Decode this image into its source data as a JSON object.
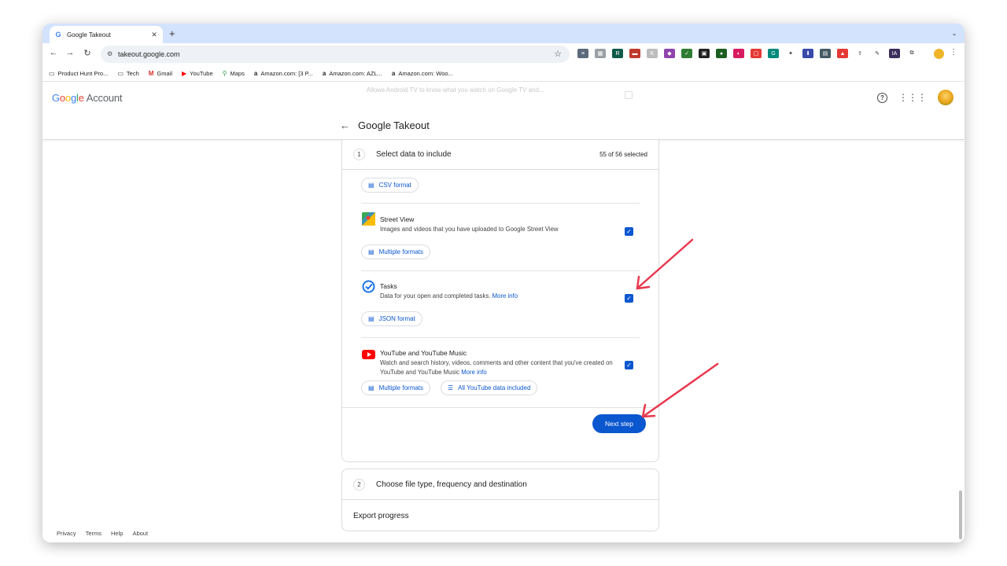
{
  "browser": {
    "tab_title": "Google Takeout",
    "tab_favicon": "G",
    "new_tab": "+",
    "url": "takeout.google.com"
  },
  "bookmarks": [
    {
      "label": "Product Hunt Pro...",
      "icon": "folder-icon",
      "glyph": "▭"
    },
    {
      "label": "Tech",
      "icon": "folder-icon",
      "glyph": "▭"
    },
    {
      "label": "Gmail",
      "icon": "gmail-icon",
      "glyph": "M"
    },
    {
      "label": "YouTube",
      "icon": "youtube-icon",
      "glyph": "▶"
    },
    {
      "label": "Maps",
      "icon": "maps-icon",
      "glyph": "⚲"
    },
    {
      "label": "Amazon.com: [3 P...",
      "icon": "amazon-icon",
      "glyph": "a"
    },
    {
      "label": "Amazon.com: AZL...",
      "icon": "amazon-icon",
      "glyph": "a"
    },
    {
      "label": "Amazon.com: Woo...",
      "icon": "amazon-icon",
      "glyph": "a"
    }
  ],
  "header": {
    "logo_google": "Google",
    "logo_account": "Account",
    "page_title": "Google Takeout",
    "ghost_text": "Allows Android TV to know what you watch on Google TV and..."
  },
  "step1": {
    "number": "1",
    "label": "Select data to include",
    "count": "55 of 56 selected"
  },
  "chips": {
    "csv": "CSV format",
    "street_multiple": "Multiple formats",
    "json": "JSON format",
    "yt_multiple": "Multiple formats",
    "yt_all": "All YouTube data included"
  },
  "products": {
    "street_view": {
      "name": "Street View",
      "desc": "Images and videos that you have uploaded to Google Street View"
    },
    "tasks": {
      "name": "Tasks",
      "desc": "Data for your open and completed tasks.",
      "more": "More info"
    },
    "youtube": {
      "name": "YouTube and YouTube Music",
      "desc": "Watch and search history, videos, comments and other content that you've created on YouTube and YouTube Music",
      "more": "More info"
    }
  },
  "next_button": "Next step",
  "step2": {
    "number": "2",
    "label": "Choose file type, frequency and destination"
  },
  "export_progress": "Export progress",
  "footer": {
    "privacy": "Privacy",
    "terms": "Terms",
    "help": "Help",
    "about": "About"
  },
  "colors": {
    "accent": "#0b57d0",
    "annotation_arrow": "#e8384f",
    "tab_strip": "#d3e3fd"
  }
}
